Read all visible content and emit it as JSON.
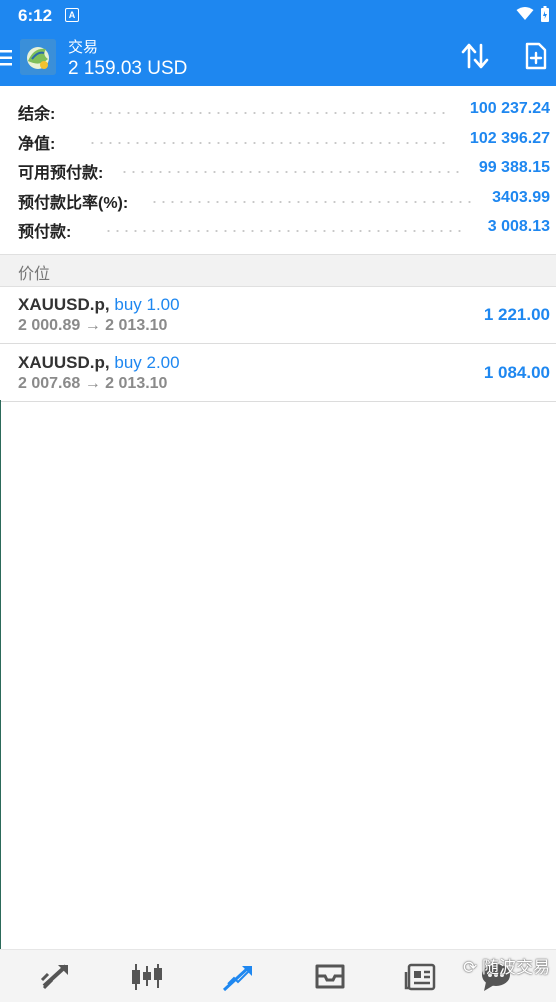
{
  "status": {
    "time": "6:12",
    "notification_icon": "A"
  },
  "header": {
    "title": "交易",
    "balance_line": "2 159.03 USD",
    "accent_color": "#1e87f0"
  },
  "summary": [
    {
      "label": "结余:",
      "value": "100 237.24"
    },
    {
      "label": "净值:",
      "value": "102 396.27"
    },
    {
      "label": "可用预付款:",
      "value": "99 388.15"
    },
    {
      "label": "预付款比率(%):",
      "value": "3403.99"
    },
    {
      "label": "预付款:",
      "value": "3 008.13"
    }
  ],
  "section_title": "价位",
  "positions": [
    {
      "symbol": "XAUUSD.p,",
      "type": "buy 1.00",
      "prices": "2 000.89 → 2 013.10",
      "profit": "1 221.00"
    },
    {
      "symbol": "XAUUSD.p,",
      "type": "buy 2.00",
      "prices": "2 007.68 → 2 013.10",
      "profit": "1 084.00"
    }
  ],
  "bottom_nav": [
    "quotes-icon",
    "chart-icon",
    "trade-icon",
    "history-icon",
    "news-icon",
    "chat-icon"
  ],
  "watermark": "随波交易"
}
